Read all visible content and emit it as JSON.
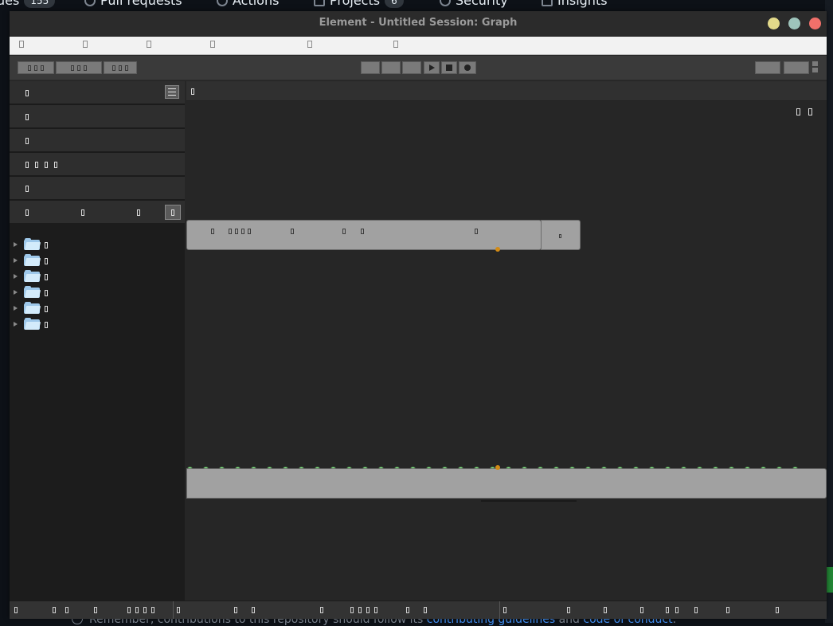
{
  "background_page": {
    "tabs": [
      {
        "label": "ues",
        "count": "155"
      },
      {
        "label": "Pull requests"
      },
      {
        "label": "Actions"
      },
      {
        "label": "Projects",
        "count": "6"
      },
      {
        "label": "Security"
      },
      {
        "label": "Insights"
      }
    ],
    "footer": {
      "prefix": "Remember, contributions to this repository should follow its ",
      "link1": "contributing guidelines",
      "middle": " and ",
      "link2": "code of conduct",
      "suffix": "."
    }
  },
  "window": {
    "title": "Element - Untitled Session: Graph",
    "controls": [
      "minimize",
      "maximize",
      "close"
    ]
  },
  "menubar": {
    "item_count": 6
  },
  "toolbar": {
    "transport": [
      "play-icon",
      "stop-icon",
      "record-icon"
    ]
  },
  "left_panel": {
    "rows": 6,
    "tree_items": 6,
    "folder_icon": "folder-icon"
  },
  "graph": {
    "node_upper_pin_count": 39
  },
  "colors": {
    "pin": "#8fe68f",
    "wire": "#d28b16",
    "node": "#a1a1a1",
    "folder": "#9ec8ea"
  }
}
